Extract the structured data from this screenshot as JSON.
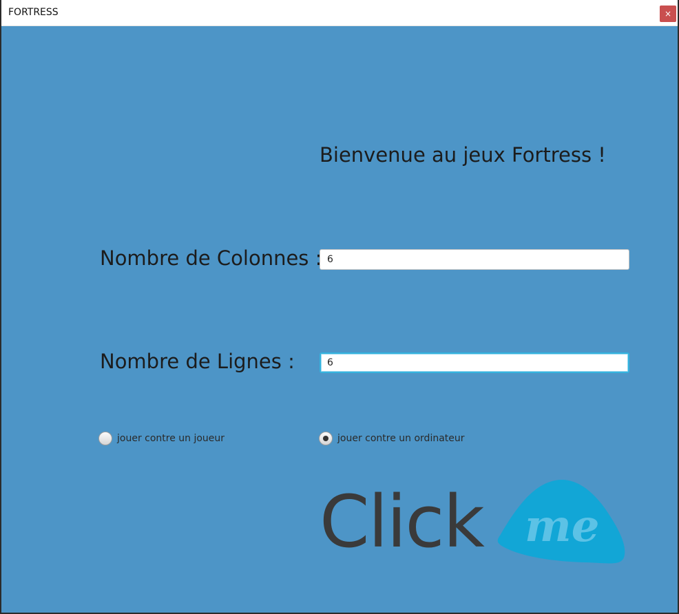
{
  "window": {
    "title": "FORTRESS",
    "close_symbol": "×"
  },
  "main": {
    "welcome": "Bienvenue au jeux Fortress !",
    "columns_label": "Nombre de Colonnes :",
    "columns_value": "6",
    "rows_label": "Nombre de Lignes :",
    "rows_value": "6",
    "radio_player_label": "jouer contre un joueur",
    "radio_player_selected": false,
    "radio_computer_label": "jouer contre un ordinateur",
    "radio_computer_selected": true
  },
  "button": {
    "logo_text_main": "Click",
    "logo_text_badge": "me",
    "badge_color": "#12a6d6"
  },
  "colors": {
    "background": "#4d95c7",
    "focus": "#34b3de",
    "close": "#c94f4f"
  }
}
